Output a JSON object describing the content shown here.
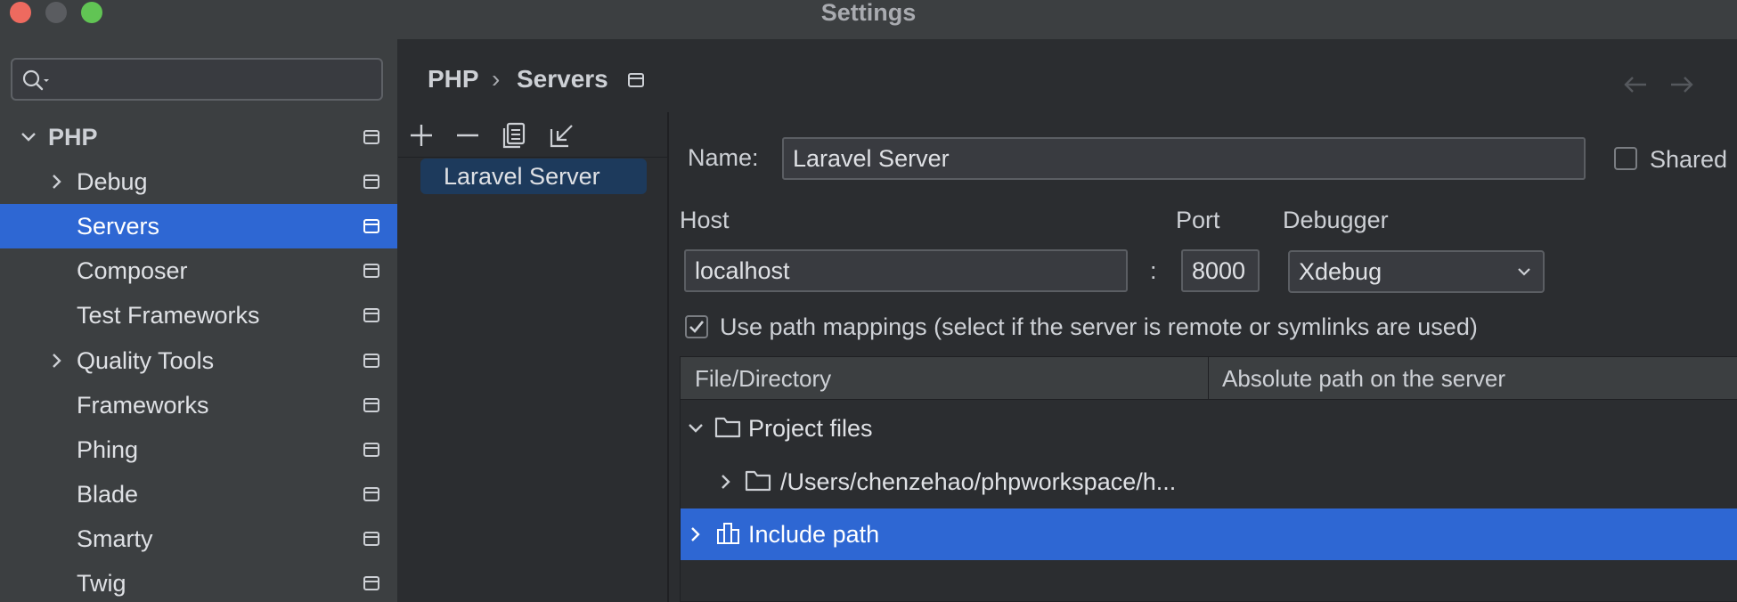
{
  "window": {
    "title": "Settings"
  },
  "sidebar": {
    "search_placeholder": "",
    "items": [
      {
        "label": "PHP",
        "expanded": true
      },
      {
        "label": "Debug",
        "expandable": true
      },
      {
        "label": "Servers",
        "selected": true
      },
      {
        "label": "Composer"
      },
      {
        "label": "Test Frameworks"
      },
      {
        "label": "Quality Tools",
        "expandable": true
      },
      {
        "label": "Frameworks"
      },
      {
        "label": "Phing"
      },
      {
        "label": "Blade"
      },
      {
        "label": "Smarty"
      },
      {
        "label": "Twig"
      }
    ]
  },
  "breadcrumb": {
    "parent": "PHP",
    "separator": "›",
    "current": "Servers"
  },
  "server_list": {
    "items": [
      "Laravel Server"
    ]
  },
  "form": {
    "name_label": "Name:",
    "name_value": "Laravel Server",
    "shared_label": "Shared",
    "shared_checked": false,
    "host_label": "Host",
    "host_value": "localhost",
    "colon": ":",
    "port_label": "Port",
    "port_value": "8000",
    "debugger_label": "Debugger",
    "debugger_value": "Xdebug",
    "use_path_mappings_label": "Use path mappings (select if the server is remote or symlinks are used)",
    "use_path_mappings_checked": true
  },
  "mappings_table": {
    "columns": [
      "File/Directory",
      "Absolute path on the server"
    ],
    "rows": [
      {
        "label": "Project files",
        "expanded": true,
        "icon": "folder-icon"
      },
      {
        "label": "/Users/chenzehao/phpworkspace/h...",
        "expanded": false,
        "icon": "folder-icon"
      },
      {
        "label": "Include path",
        "expanded": false,
        "icon": "library-icon",
        "selected": true
      }
    ]
  },
  "colors": {
    "accent": "#2e67d3",
    "close": "#ee6a5f",
    "minimize": "#5a5c60",
    "zoom": "#61c454"
  }
}
